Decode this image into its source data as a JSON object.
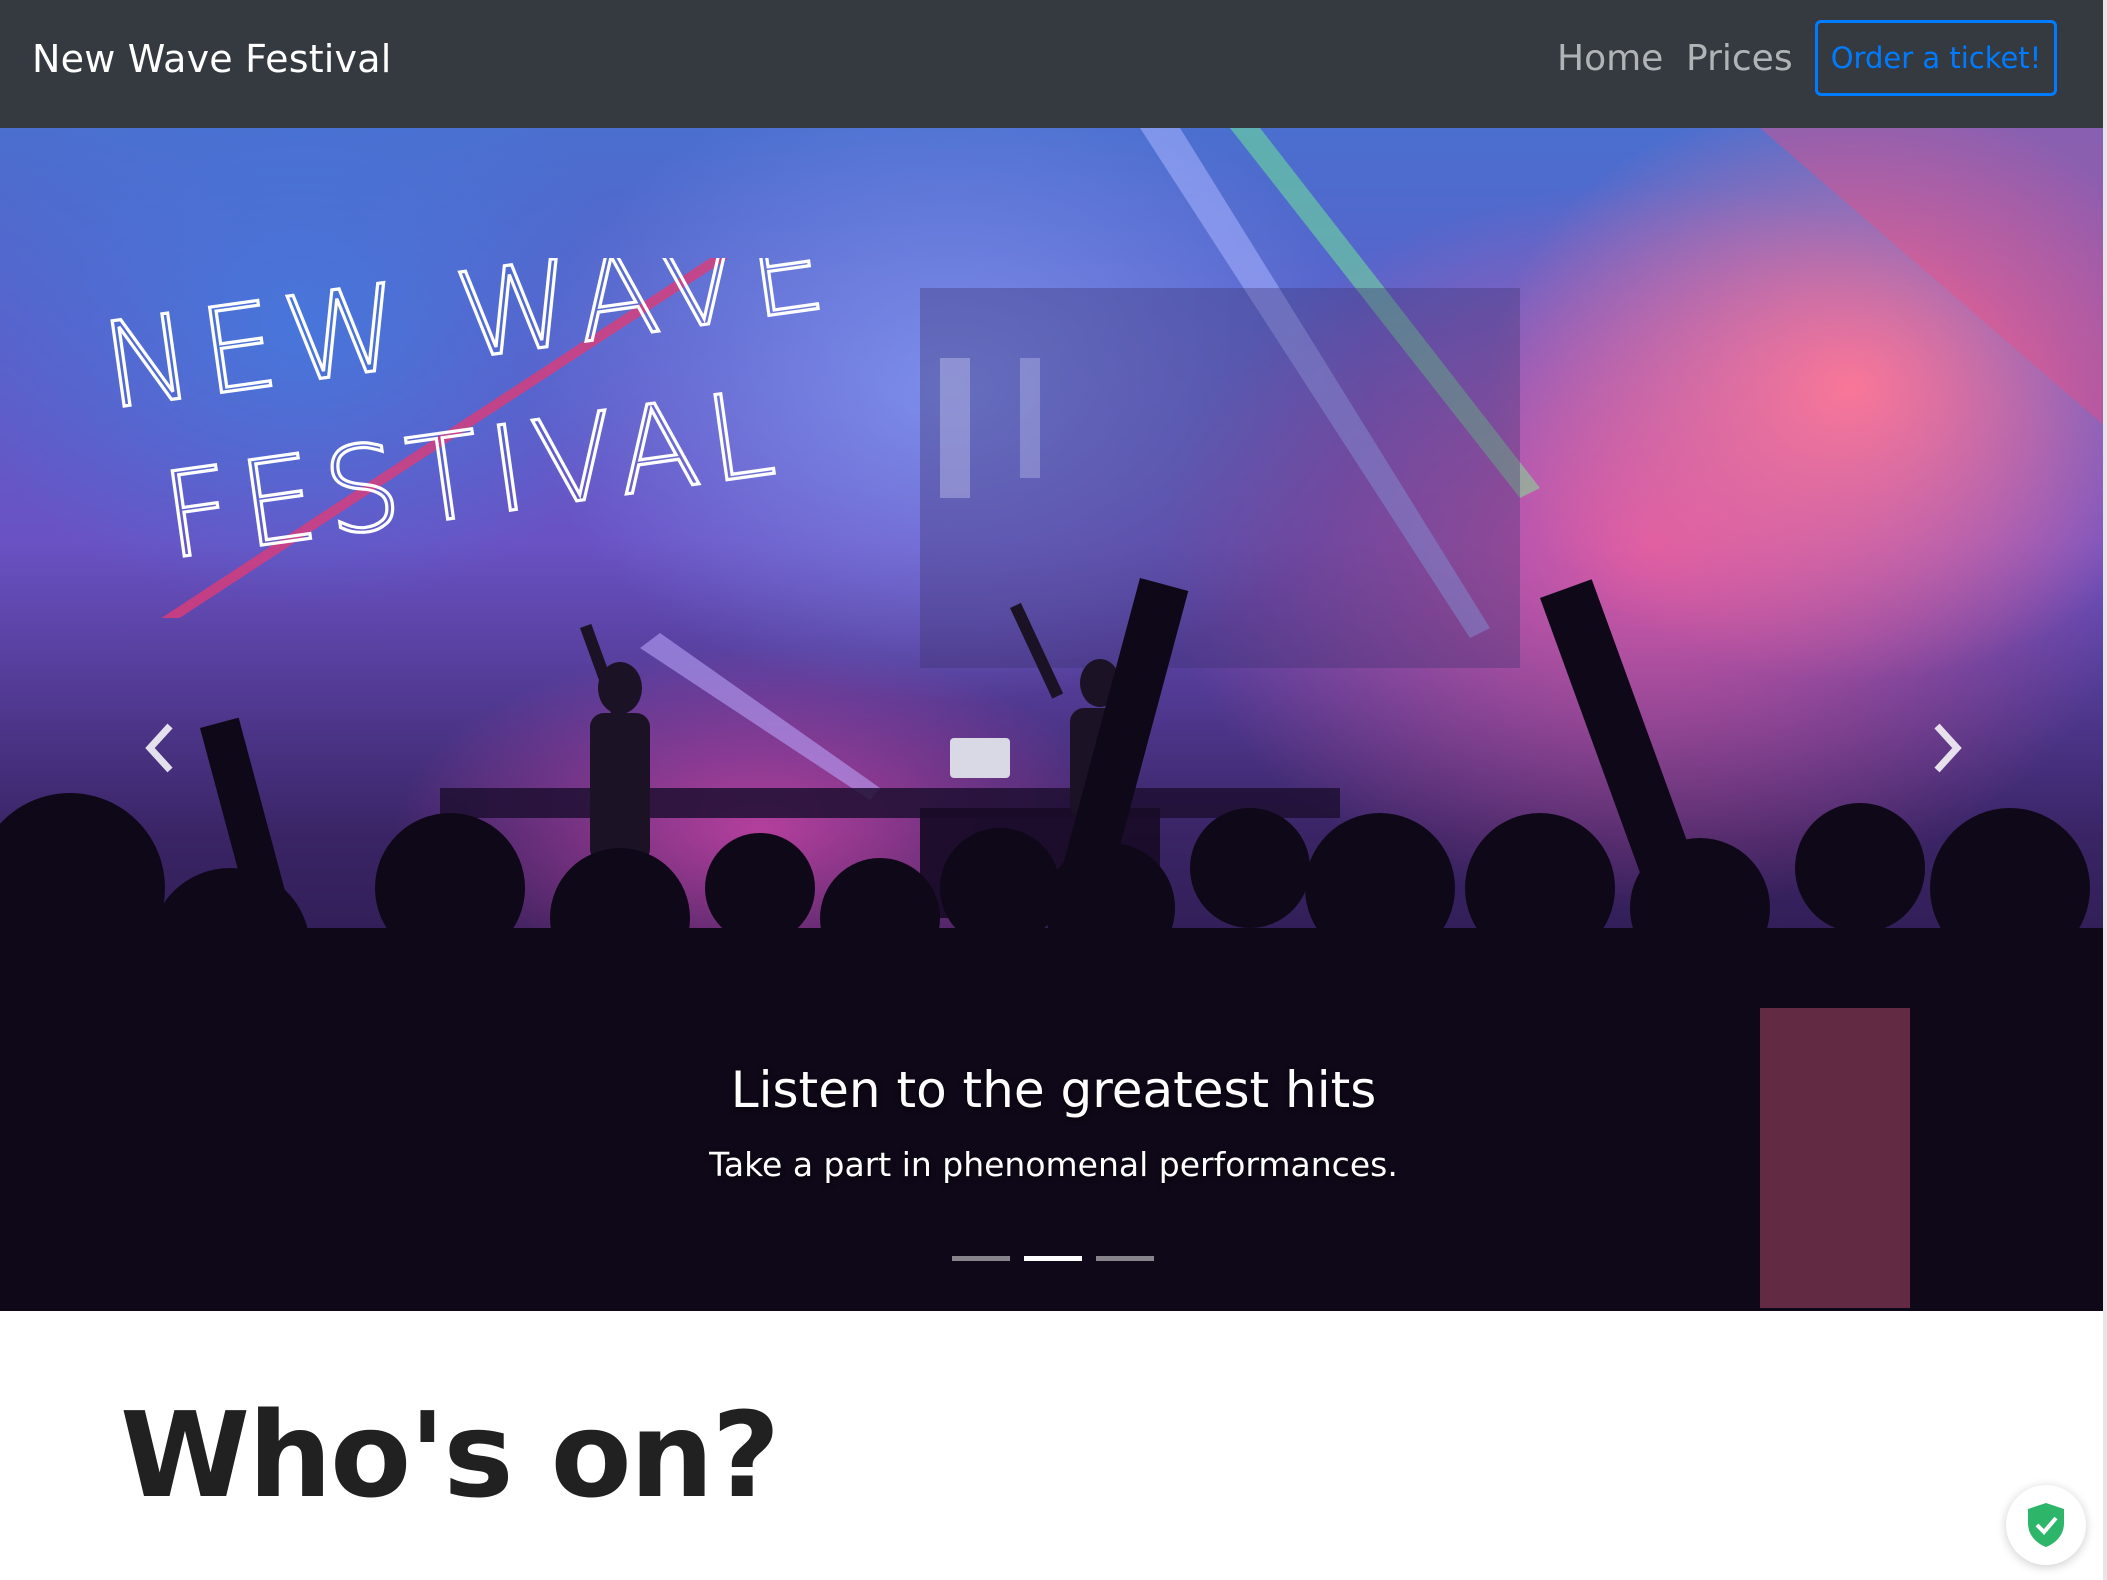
{
  "navbar": {
    "brand": "New Wave Festival",
    "links": [
      {
        "label": "Home"
      },
      {
        "label": "Prices"
      }
    ],
    "cta": "Order a ticket!"
  },
  "carousel": {
    "logo_line1": "NEW WAVE",
    "logo_line2": "FESTIVAL",
    "caption_title": "Listen to the greatest hits",
    "caption_text": "Take a part in phenomenal performances.",
    "slide_count": 3,
    "active_slide": 2,
    "prev_icon": "chevron-left-icon",
    "next_icon": "chevron-right-icon"
  },
  "main": {
    "heading": "Who's on?"
  },
  "badge": {
    "icon": "shield-check-icon"
  },
  "colors": {
    "navbar_bg": "#343a40",
    "primary": "#007bff",
    "shield_green": "#2db56a"
  }
}
